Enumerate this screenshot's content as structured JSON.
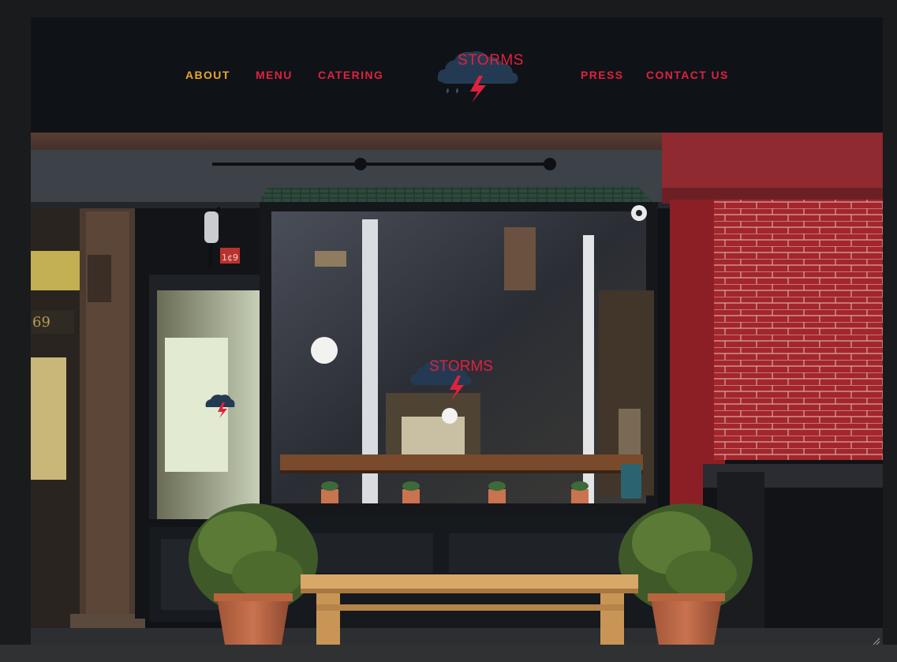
{
  "nav": {
    "left_items": [
      {
        "label": "ABOUT",
        "active": true
      },
      {
        "label": "MENU",
        "active": false
      },
      {
        "label": "CATERING",
        "active": false
      }
    ],
    "right_items": [
      {
        "label": "PRESS",
        "active": false
      },
      {
        "label": "CONTACT US",
        "active": false
      }
    ],
    "logo_text": "STORMS"
  },
  "hero": {
    "window_logo_text": "STORMS",
    "street_number": "69",
    "door_sign": "1¢9"
  },
  "colors": {
    "brand_red": "#e0213e",
    "active_gold": "#e8a62b",
    "nav_background": "#0f1318",
    "page_background": "#1a1b1d"
  }
}
